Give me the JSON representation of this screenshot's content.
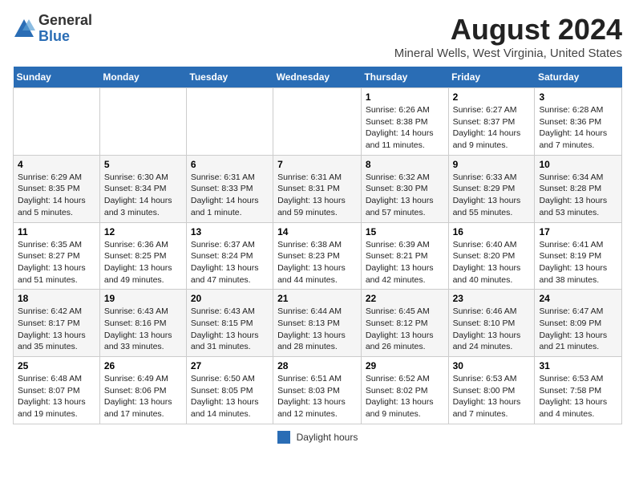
{
  "logo": {
    "general": "General",
    "blue": "Blue"
  },
  "title": "August 2024",
  "subtitle": "Mineral Wells, West Virginia, United States",
  "days_of_week": [
    "Sunday",
    "Monday",
    "Tuesday",
    "Wednesday",
    "Thursday",
    "Friday",
    "Saturday"
  ],
  "footer": {
    "legend_label": "Daylight hours"
  },
  "weeks": [
    [
      {
        "day": "",
        "content": ""
      },
      {
        "day": "",
        "content": ""
      },
      {
        "day": "",
        "content": ""
      },
      {
        "day": "",
        "content": ""
      },
      {
        "day": "1",
        "content": "Sunrise: 6:26 AM\nSunset: 8:38 PM\nDaylight: 14 hours and 11 minutes."
      },
      {
        "day": "2",
        "content": "Sunrise: 6:27 AM\nSunset: 8:37 PM\nDaylight: 14 hours and 9 minutes."
      },
      {
        "day": "3",
        "content": "Sunrise: 6:28 AM\nSunset: 8:36 PM\nDaylight: 14 hours and 7 minutes."
      }
    ],
    [
      {
        "day": "4",
        "content": "Sunrise: 6:29 AM\nSunset: 8:35 PM\nDaylight: 14 hours and 5 minutes."
      },
      {
        "day": "5",
        "content": "Sunrise: 6:30 AM\nSunset: 8:34 PM\nDaylight: 14 hours and 3 minutes."
      },
      {
        "day": "6",
        "content": "Sunrise: 6:31 AM\nSunset: 8:33 PM\nDaylight: 14 hours and 1 minute."
      },
      {
        "day": "7",
        "content": "Sunrise: 6:31 AM\nSunset: 8:31 PM\nDaylight: 13 hours and 59 minutes."
      },
      {
        "day": "8",
        "content": "Sunrise: 6:32 AM\nSunset: 8:30 PM\nDaylight: 13 hours and 57 minutes."
      },
      {
        "day": "9",
        "content": "Sunrise: 6:33 AM\nSunset: 8:29 PM\nDaylight: 13 hours and 55 minutes."
      },
      {
        "day": "10",
        "content": "Sunrise: 6:34 AM\nSunset: 8:28 PM\nDaylight: 13 hours and 53 minutes."
      }
    ],
    [
      {
        "day": "11",
        "content": "Sunrise: 6:35 AM\nSunset: 8:27 PM\nDaylight: 13 hours and 51 minutes."
      },
      {
        "day": "12",
        "content": "Sunrise: 6:36 AM\nSunset: 8:25 PM\nDaylight: 13 hours and 49 minutes."
      },
      {
        "day": "13",
        "content": "Sunrise: 6:37 AM\nSunset: 8:24 PM\nDaylight: 13 hours and 47 minutes."
      },
      {
        "day": "14",
        "content": "Sunrise: 6:38 AM\nSunset: 8:23 PM\nDaylight: 13 hours and 44 minutes."
      },
      {
        "day": "15",
        "content": "Sunrise: 6:39 AM\nSunset: 8:21 PM\nDaylight: 13 hours and 42 minutes."
      },
      {
        "day": "16",
        "content": "Sunrise: 6:40 AM\nSunset: 8:20 PM\nDaylight: 13 hours and 40 minutes."
      },
      {
        "day": "17",
        "content": "Sunrise: 6:41 AM\nSunset: 8:19 PM\nDaylight: 13 hours and 38 minutes."
      }
    ],
    [
      {
        "day": "18",
        "content": "Sunrise: 6:42 AM\nSunset: 8:17 PM\nDaylight: 13 hours and 35 minutes."
      },
      {
        "day": "19",
        "content": "Sunrise: 6:43 AM\nSunset: 8:16 PM\nDaylight: 13 hours and 33 minutes."
      },
      {
        "day": "20",
        "content": "Sunrise: 6:43 AM\nSunset: 8:15 PM\nDaylight: 13 hours and 31 minutes."
      },
      {
        "day": "21",
        "content": "Sunrise: 6:44 AM\nSunset: 8:13 PM\nDaylight: 13 hours and 28 minutes."
      },
      {
        "day": "22",
        "content": "Sunrise: 6:45 AM\nSunset: 8:12 PM\nDaylight: 13 hours and 26 minutes."
      },
      {
        "day": "23",
        "content": "Sunrise: 6:46 AM\nSunset: 8:10 PM\nDaylight: 13 hours and 24 minutes."
      },
      {
        "day": "24",
        "content": "Sunrise: 6:47 AM\nSunset: 8:09 PM\nDaylight: 13 hours and 21 minutes."
      }
    ],
    [
      {
        "day": "25",
        "content": "Sunrise: 6:48 AM\nSunset: 8:07 PM\nDaylight: 13 hours and 19 minutes."
      },
      {
        "day": "26",
        "content": "Sunrise: 6:49 AM\nSunset: 8:06 PM\nDaylight: 13 hours and 17 minutes."
      },
      {
        "day": "27",
        "content": "Sunrise: 6:50 AM\nSunset: 8:05 PM\nDaylight: 13 hours and 14 minutes."
      },
      {
        "day": "28",
        "content": "Sunrise: 6:51 AM\nSunset: 8:03 PM\nDaylight: 13 hours and 12 minutes."
      },
      {
        "day": "29",
        "content": "Sunrise: 6:52 AM\nSunset: 8:02 PM\nDaylight: 13 hours and 9 minutes."
      },
      {
        "day": "30",
        "content": "Sunrise: 6:53 AM\nSunset: 8:00 PM\nDaylight: 13 hours and 7 minutes."
      },
      {
        "day": "31",
        "content": "Sunrise: 6:53 AM\nSunset: 7:58 PM\nDaylight: 13 hours and 4 minutes."
      }
    ]
  ]
}
